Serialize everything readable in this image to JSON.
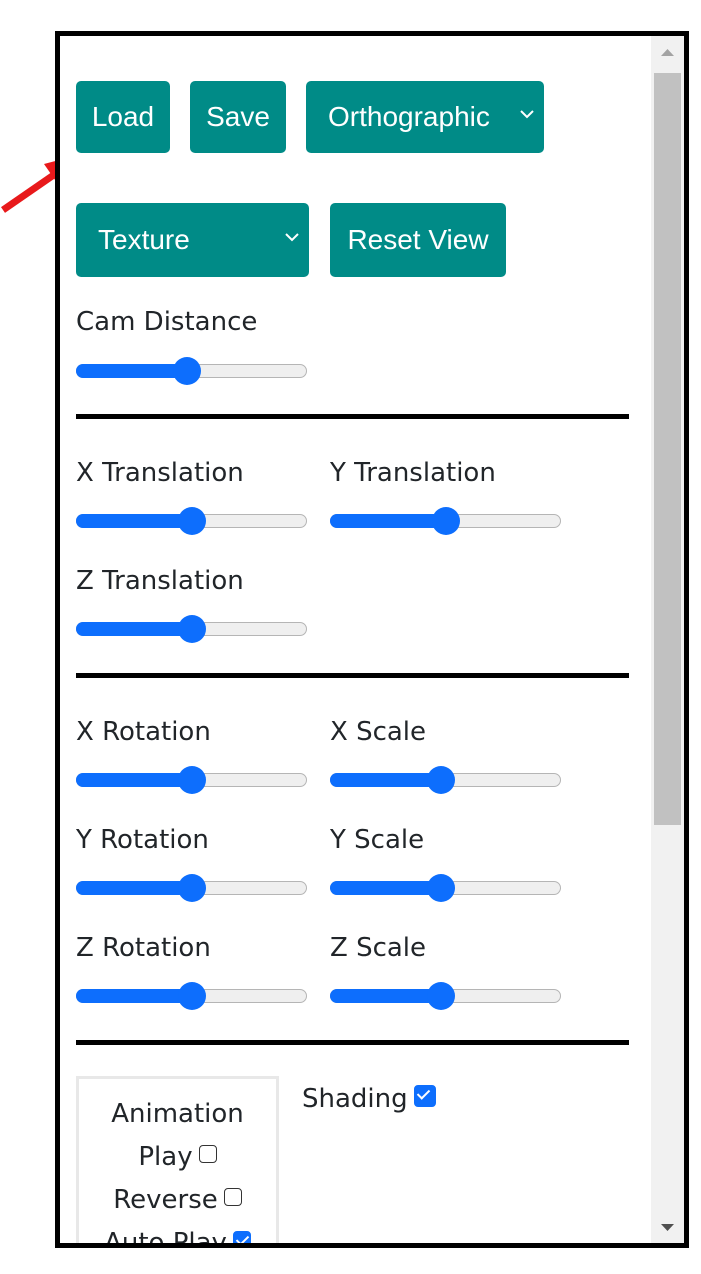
{
  "toolbar": {
    "load_label": "Load",
    "save_label": "Save",
    "projection_value": "Orthographic",
    "render_mode_value": "Texture",
    "reset_label": "Reset View"
  },
  "camera": {
    "distance_label": "Cam Distance",
    "distance_value": 0.48
  },
  "translation": {
    "x_label": "X Translation",
    "x_value": 0.5,
    "y_label": "Y Translation",
    "y_value": 0.5,
    "z_label": "Z Translation",
    "z_value": 0.5
  },
  "rotation_scale": {
    "x_rot_label": "X Rotation",
    "x_rot_value": 0.5,
    "x_scale_label": "X Scale",
    "x_scale_value": 0.48,
    "y_rot_label": "Y Rotation",
    "y_rot_value": 0.5,
    "y_scale_label": "Y Scale",
    "y_scale_value": 0.48,
    "z_rot_label": "Z Rotation",
    "z_rot_value": 0.5,
    "z_scale_label": "Z Scale",
    "z_scale_value": 0.48
  },
  "animation": {
    "title": "Animation",
    "play_label": "Play",
    "play_checked": false,
    "reverse_label": "Reverse",
    "reverse_checked": false,
    "autoplay_label": "Auto Play",
    "autoplay_checked": true
  },
  "shading": {
    "label": "Shading",
    "checked": true
  },
  "colors": {
    "button_bg": "#008b87",
    "slider_accent": "#0d6efd",
    "arrow": "#e8191b"
  },
  "icons": {
    "dropdown": "chevron-down-icon",
    "annotation": "red-arrow-icon",
    "scroll_up": "triangle-up-icon",
    "scroll_down": "triangle-down-icon"
  }
}
